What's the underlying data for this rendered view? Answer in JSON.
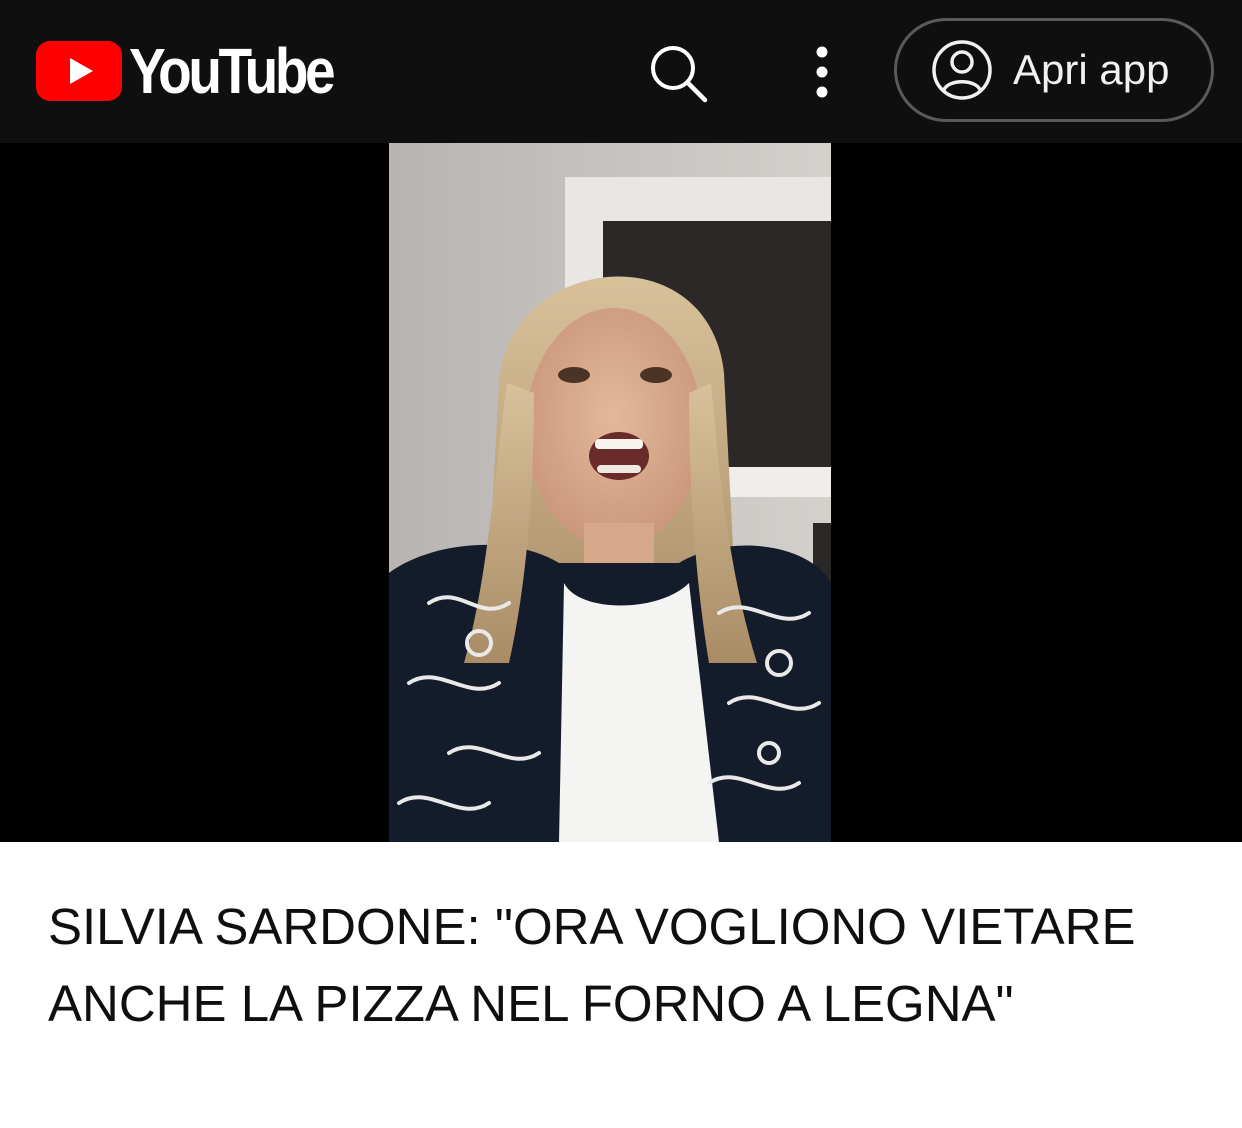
{
  "header": {
    "logo_text": "YouTube",
    "logo_icon": "youtube-play-icon",
    "search_icon": "search-icon",
    "more_icon": "more-vertical-icon",
    "open_app_label": "Apri app",
    "account_icon": "account-circle-icon"
  },
  "video": {
    "title": "SILVIA SARDONE: \"ORA VOGLIONO VIETARE ANCHE LA PIZZA NEL FORNO A LEGNA\""
  },
  "colors": {
    "header_bg": "#0f0f0f",
    "brand_red": "#ff0000",
    "player_bg": "#000000",
    "page_bg": "#ffffff",
    "title_text": "#0f0f0f"
  }
}
